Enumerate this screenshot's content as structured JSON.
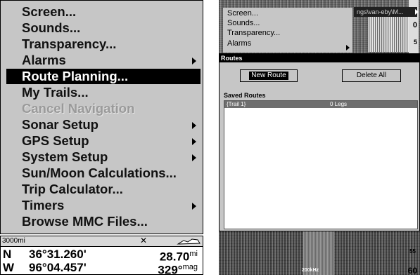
{
  "left_menu": {
    "items": [
      {
        "label": "Screen...",
        "state": "normal",
        "submenu": false
      },
      {
        "label": "Sounds...",
        "state": "normal",
        "submenu": false
      },
      {
        "label": "Transparency...",
        "state": "normal",
        "submenu": false
      },
      {
        "label": "Alarms",
        "state": "normal",
        "submenu": true
      },
      {
        "label": "Route Planning...",
        "state": "selected",
        "submenu": false
      },
      {
        "label": "My Trails...",
        "state": "normal",
        "submenu": false
      },
      {
        "label": "Cancel Navigation",
        "state": "disabled",
        "submenu": false
      },
      {
        "label": "Sonar Setup",
        "state": "normal",
        "submenu": true
      },
      {
        "label": "GPS Setup",
        "state": "normal",
        "submenu": true
      },
      {
        "label": "System Setup",
        "state": "normal",
        "submenu": true
      },
      {
        "label": "Sun/Moon Calculations...",
        "state": "normal",
        "submenu": false
      },
      {
        "label": "Trip Calculator...",
        "state": "normal",
        "submenu": false
      },
      {
        "label": "Timers",
        "state": "normal",
        "submenu": true
      },
      {
        "label": "Browse MMC Files...",
        "state": "normal",
        "submenu": false
      }
    ]
  },
  "status": {
    "scale": "3000mi",
    "lat_dir": "N",
    "lat": "36°31.260'",
    "lon_dir": "W",
    "lon": "96°04.457'",
    "distance": "28.70",
    "distance_unit": "mi",
    "bearing": "329°",
    "bearing_unit": "mag"
  },
  "right_panel": {
    "context_menu": [
      "Screen...",
      "Sounds...",
      "Transparency...",
      "Alarms"
    ],
    "path_text": "ngs\\van-eby\\M...",
    "depth_top": "0",
    "depth_top_tick": "5",
    "routes_title": "Routes",
    "new_route_label": "New Route",
    "delete_all_label": "Delete All",
    "saved_routes_label": "Saved Routes",
    "routes": [
      {
        "name": "{Trail 1}",
        "legs": "0 Legs"
      }
    ],
    "frequency": "200kHz",
    "depth_bottom": "60",
    "depth_bottom_tick": "55"
  },
  "colors": {
    "menu_bg": "#c6c6c6",
    "selected_bg": "#000000",
    "disabled_text": "#9a9a9a"
  }
}
